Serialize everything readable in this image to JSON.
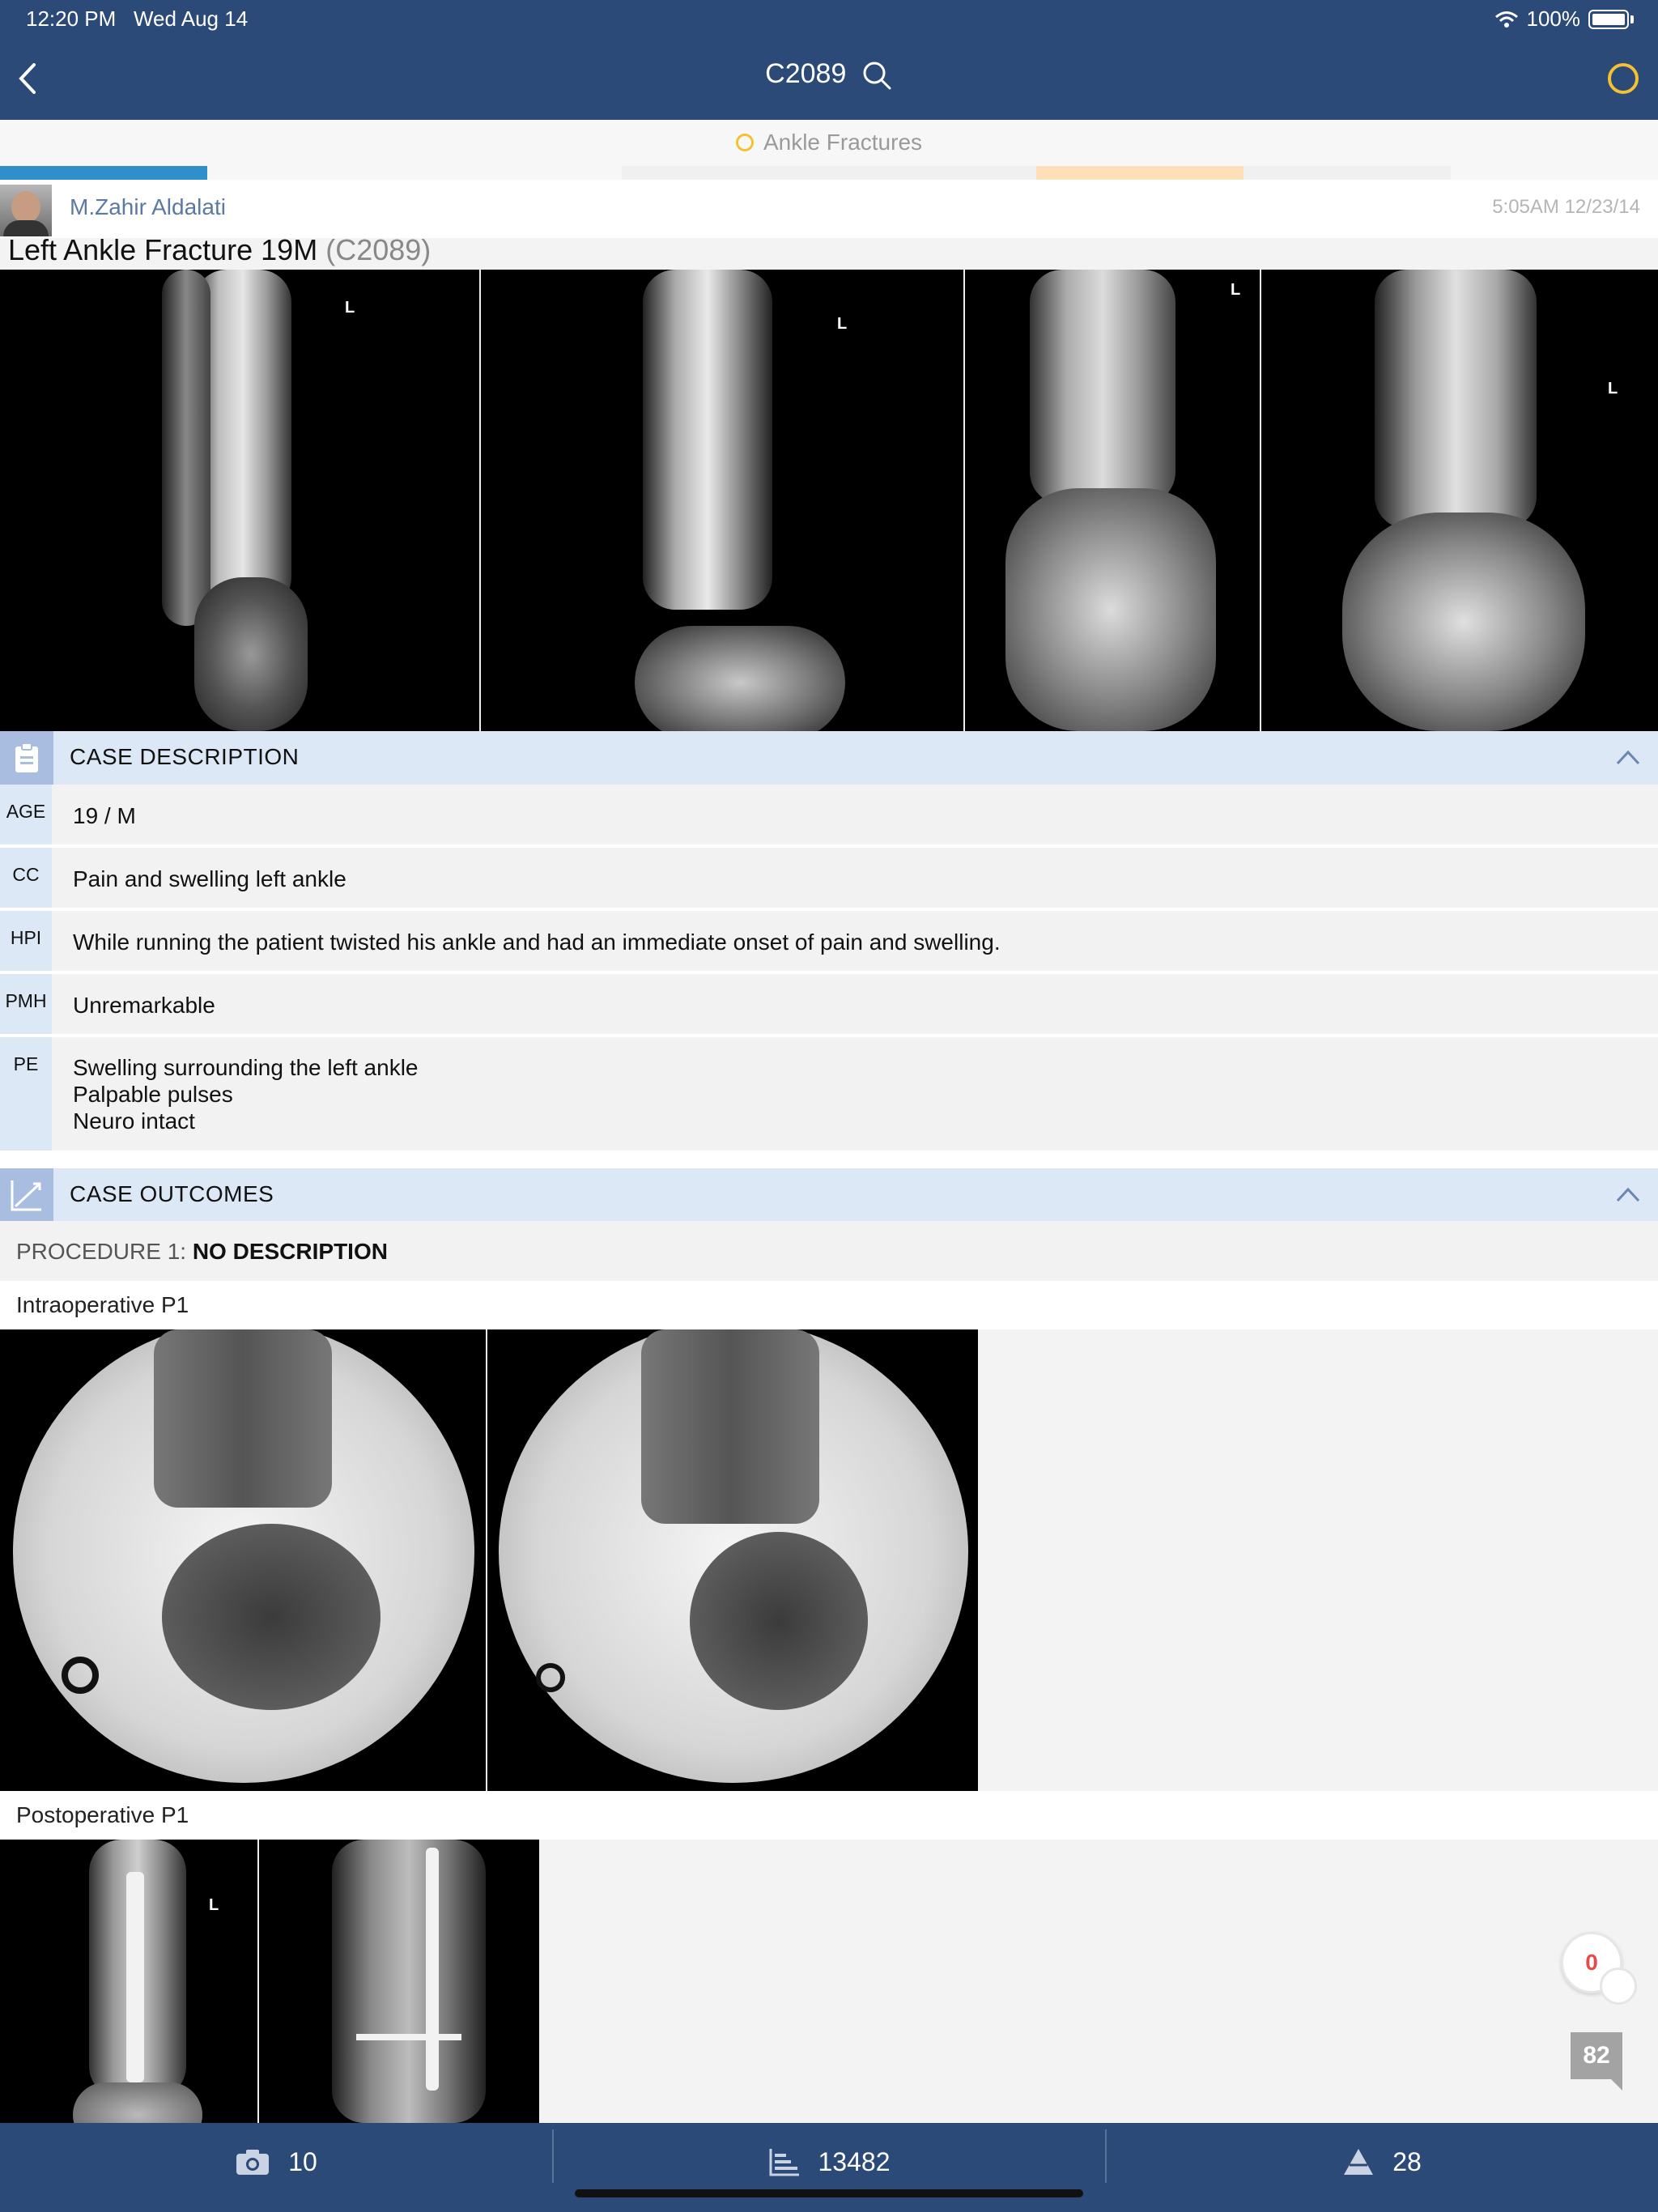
{
  "status_bar": {
    "time": "12:20 PM",
    "date": "Wed Aug 14",
    "battery": "100%"
  },
  "nav": {
    "title": "C2089"
  },
  "category": {
    "label": "Ankle Fractures"
  },
  "colors": {
    "header": "#2c4a78",
    "accent_yellow": "#f4c132",
    "section_bg": "#dde8f6",
    "seg_blue": "#2f8ecb",
    "seg_peach": "#fde0b8"
  },
  "author": {
    "name": "M.Zahir Aldalati",
    "timestamp": "5:05AM 12/23/14"
  },
  "case": {
    "title": "Left Ankle Fracture 19M",
    "code": "(C2089)"
  },
  "preop_images": [
    {
      "marker": "L"
    },
    {
      "marker": "L"
    },
    {
      "marker": "L"
    },
    {
      "marker": "L"
    }
  ],
  "description": {
    "header": "CASE DESCRIPTION",
    "rows": [
      {
        "key": "AGE",
        "value": "19 / M"
      },
      {
        "key": "CC",
        "value": "Pain and swelling left ankle"
      },
      {
        "key": "HPI",
        "value": "While running the patient twisted his ankle and had an immediate onset of pain and swelling."
      },
      {
        "key": "PMH",
        "value": "Unremarkable"
      },
      {
        "key": "PE",
        "value": "Swelling surrounding the left ankle\nPalpable pulses\nNeuro intact"
      }
    ]
  },
  "outcomes": {
    "header": "CASE OUTCOMES",
    "procedure_prefix": "PROCEDURE 1: ",
    "procedure_desc": "NO DESCRIPTION",
    "intraop_label": "Intraoperative P1",
    "postop_label": "Postoperative P1",
    "postop_marker": "L"
  },
  "floating": {
    "likes": "0",
    "comments": "82"
  },
  "tabbar": {
    "photos": {
      "icon": "camera-icon",
      "count": "10"
    },
    "views": {
      "icon": "bar-chart-icon",
      "count": "13482"
    },
    "rank": {
      "icon": "pyramid-icon",
      "count": "28"
    }
  }
}
